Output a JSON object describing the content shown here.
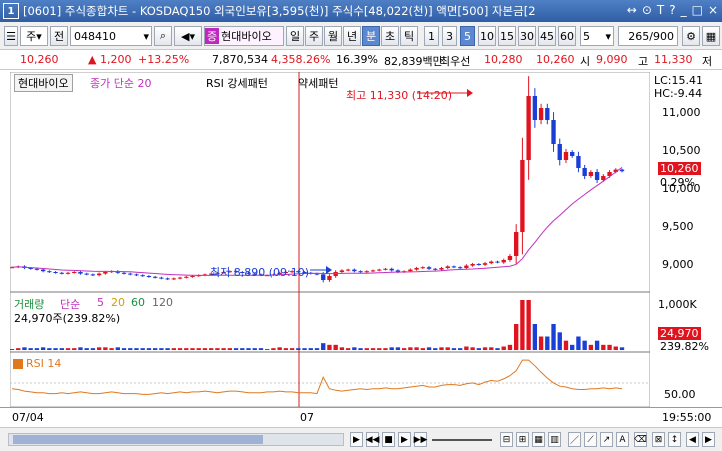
{
  "window": {
    "number": "1",
    "title": "[0601] 주식종합차트 - KOSDAQ150 외국인보유[3,595(천)] 주식수[48,022(천)] 액면[500] 자본금[2",
    "buttons": [
      "↔",
      "⊙",
      "T",
      "?",
      "_",
      "□",
      "×"
    ]
  },
  "toolbar": {
    "market": "주",
    "term": "전",
    "code": "048410",
    "stock_name": "현대바이오",
    "periods": [
      "일",
      "주",
      "월",
      "년",
      "분",
      "초",
      "틱"
    ],
    "selected_period": "분",
    "minutes": [
      "1",
      "3",
      "5",
      "10",
      "15",
      "30",
      "45",
      "60"
    ],
    "selected_minute": "5",
    "interval_value": "5",
    "count": "265",
    "count_total": "/900"
  },
  "info": {
    "price": "10,260",
    "change": "▲ 1,200",
    "change_pct": "+13.25%",
    "volume": "7,870,534",
    "vol_pct": "4,358.26%",
    "turnover": "16.39%",
    "amount": "82,839백만",
    "best_label": "최우선",
    "best1": "10,280",
    "best2": "10,260",
    "open_label": "시",
    "open": "9,090",
    "high_label": "고",
    "high": "11,330",
    "low_label": "저"
  },
  "price_panel": {
    "name_tag": "현대바이오",
    "ma_label": "종가 단순 20",
    "rsi_pattern": "RSI 강세패턴",
    "weak_pattern": "약세패턴",
    "high_annot": "최고 11,330 (14:20)",
    "low_annot": "최저 8,890 (09:10)",
    "lc": "LC:15.41",
    "hc": "HC:-9.44",
    "yticks": [
      "11,000",
      "10,500",
      "10,000",
      "9,500",
      "9,000"
    ],
    "cur_price": "10,260",
    "cur_pct": "0.29%"
  },
  "volume_panel": {
    "label": "거래량",
    "ma_label": "단순",
    "ma_periods": [
      "5",
      "20",
      "60",
      "120"
    ],
    "value": "24,970주(239.82%)",
    "ytick": "1,000K",
    "cur_value": "24,970",
    "cur_pct": "239.82%"
  },
  "rsi_panel": {
    "label": "RSI 14",
    "ytick": "50.00"
  },
  "xaxis": {
    "labels": [
      "07/04",
      "07"
    ],
    "time": "19:55:00"
  },
  "colors": {
    "up": "#e0141e",
    "down": "#1a3fd6",
    "ma20": "#c030c0",
    "rsi": "#e07820",
    "titlebar": "#3b6bb5"
  },
  "chart_data": {
    "type": "candlestick",
    "interval": "5분",
    "price_range": [
      8800,
      11450
    ],
    "annotations": [
      {
        "label": "최고",
        "value": 11330,
        "time": "14:20"
      },
      {
        "label": "최저",
        "value": 8890,
        "time": "09:10"
      }
    ],
    "last_close": 10260,
    "close_series": [
      9060,
      9070,
      9050,
      9040,
      9030,
      9010,
      9000,
      8990,
      8980,
      8990,
      9000,
      8980,
      8970,
      8960,
      8980,
      9000,
      9010,
      8990,
      8980,
      8970,
      8960,
      8950,
      8940,
      8930,
      8920,
      8910,
      8920,
      8930,
      8940,
      8950,
      8960,
      8970,
      8980,
      8990,
      9000,
      9010,
      9000,
      8990,
      8980,
      8970,
      8960,
      8960,
      8970,
      8990,
      9000,
      9010,
      9000,
      8990,
      8980,
      8970,
      8900,
      8950,
      9000,
      9020,
      9030,
      9010,
      9000,
      9010,
      9020,
      9030,
      9040,
      9020,
      9000,
      9010,
      9030,
      9050,
      9060,
      9040,
      9030,
      9050,
      9070,
      9060,
      9050,
      9080,
      9100,
      9090,
      9110,
      9130,
      9120,
      9150,
      9200,
      9500,
      10400,
      11200,
      10900,
      11050,
      10900,
      10600,
      10400,
      10500,
      10450,
      10300,
      10200,
      10250,
      10150,
      10200,
      10250,
      10280,
      10260
    ],
    "rsi_series": [
      50,
      49,
      47,
      46,
      45,
      45,
      44,
      44,
      45,
      44,
      45,
      46,
      45,
      44,
      44,
      45,
      46,
      45,
      44,
      44,
      44,
      43,
      43,
      44,
      45,
      44,
      45,
      46,
      45,
      46,
      46,
      47,
      46,
      45,
      46,
      47,
      47,
      46,
      45,
      45,
      45,
      46,
      46,
      47,
      46,
      46,
      45,
      45,
      45,
      44,
      64,
      50,
      48,
      47,
      48,
      49,
      50,
      49,
      50,
      50,
      51,
      50,
      50,
      51,
      52,
      53,
      54,
      52,
      52,
      54,
      55,
      55,
      54,
      56,
      57,
      55,
      58,
      60,
      59,
      62,
      66,
      72,
      85,
      85,
      78,
      70,
      63,
      57,
      53,
      52,
      50,
      49,
      49,
      50,
      50,
      51,
      50,
      51,
      50
    ]
  }
}
